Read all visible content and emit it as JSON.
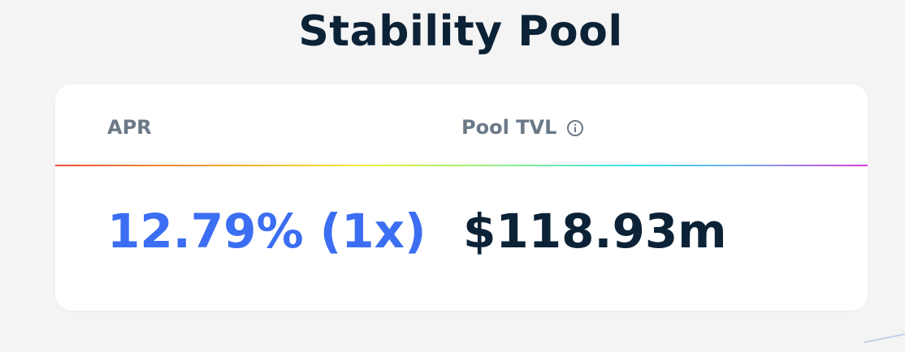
{
  "page": {
    "title": "Stability Pool"
  },
  "stats": {
    "apr_label": "APR",
    "apr_value": "12.79% (1x)",
    "tvl_label": "Pool TVL",
    "tvl_value": "$118.93m"
  },
  "colors": {
    "title": "#0c2236",
    "label": "#6b7987",
    "apr_accent": "#3b6ef2",
    "tvl_value": "#0c2236",
    "background": "#f4f4f5",
    "card": "#ffffff"
  },
  "icons": {
    "tvl_info": "info-icon"
  }
}
